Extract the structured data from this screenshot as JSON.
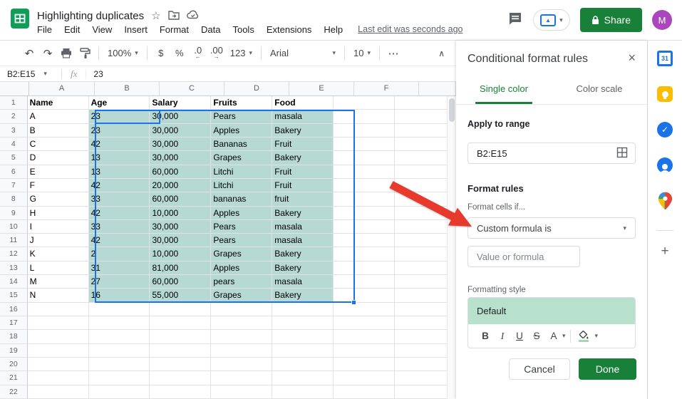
{
  "icons": {
    "star": "☆",
    "undo": "↶",
    "redo": "↷",
    "caret": "▾",
    "more": "⋯",
    "collapse": "∧",
    "close": "×",
    "plus": "+",
    "arrow_left": "←",
    "arrow_right": "→",
    "fx": "fx",
    "present_arrow": "▲",
    "check": "✓"
  },
  "titlebar": {
    "title": "Highlighting duplicates",
    "menu": [
      "File",
      "Edit",
      "View",
      "Insert",
      "Format",
      "Data",
      "Tools",
      "Extensions",
      "Help"
    ],
    "last_edit": "Last edit was seconds ago",
    "share_label": "Share",
    "avatar_letter": "M"
  },
  "toolbar": {
    "zoom": "100%",
    "currency": "$",
    "percent": "%",
    "decrease_decimal": ".0",
    "increase_decimal": ".00",
    "more_formats": "123",
    "font_name": "Arial",
    "font_size": "10"
  },
  "formula_bar": {
    "name_box": "B2:E15",
    "value": "23"
  },
  "spreadsheet": {
    "columns": [
      "A",
      "B",
      "C",
      "D",
      "E",
      "F"
    ],
    "header_row": [
      "Name",
      "Age",
      "Salary",
      "Fruits",
      "Food"
    ],
    "rows": [
      [
        "A",
        "23",
        "30,000",
        "Pears",
        "masala"
      ],
      [
        "B",
        "23",
        "30,000",
        "Apples",
        "Bakery"
      ],
      [
        "C",
        "42",
        "30,000",
        "Bananas",
        "Fruit"
      ],
      [
        "D",
        "13",
        "30,000",
        "Grapes",
        "Bakery"
      ],
      [
        "E",
        "13",
        "60,000",
        "Litchi",
        "Fruit"
      ],
      [
        "F",
        "42",
        "20,000",
        "Litchi",
        "Fruit"
      ],
      [
        "G",
        "33",
        "60,000",
        "bananas",
        "fruit"
      ],
      [
        "H",
        "42",
        "10,000",
        "Apples",
        "Bakery"
      ],
      [
        "I",
        "33",
        "30,000",
        "Pears",
        "masala"
      ],
      [
        "J",
        "42",
        "30,000",
        "Pears",
        "masala"
      ],
      [
        "K",
        "2",
        "10,000",
        "Grapes",
        "Bakery"
      ],
      [
        "L",
        "31",
        "81,000",
        "Apples",
        "Bakery"
      ],
      [
        "M",
        "27",
        "60,000",
        "pears",
        "masala"
      ],
      [
        "N",
        "16",
        "55,000",
        "Grapes",
        "Bakery"
      ]
    ],
    "visible_rows": 22,
    "selection": {
      "range": "B2:E15",
      "active_cell": "B2"
    }
  },
  "panel": {
    "title": "Conditional format rules",
    "tabs": [
      {
        "label": "Single color",
        "active": true
      },
      {
        "label": "Color scale",
        "active": false
      }
    ],
    "apply_to_range_label": "Apply to range",
    "range_value": "B2:E15",
    "format_rules_label": "Format rules",
    "format_cells_if_label": "Format cells if...",
    "condition_value": "Custom formula is",
    "value_placeholder": "Value or formula",
    "formatting_style_label": "Formatting style",
    "style_preview_label": "Default",
    "style_buttons": {
      "bold": "B",
      "italic": "I",
      "underline": "U",
      "strikethrough": "S",
      "text_color": "A"
    },
    "cancel_label": "Cancel",
    "done_label": "Done"
  },
  "colors": {
    "accent_green": "#188038",
    "selection_fill": "#b7d9d4",
    "selection_border": "#1a73e8",
    "preview_green": "#b7e1cd",
    "arrow_red": "#e8392d",
    "avatar_purple": "#ab47bc"
  }
}
